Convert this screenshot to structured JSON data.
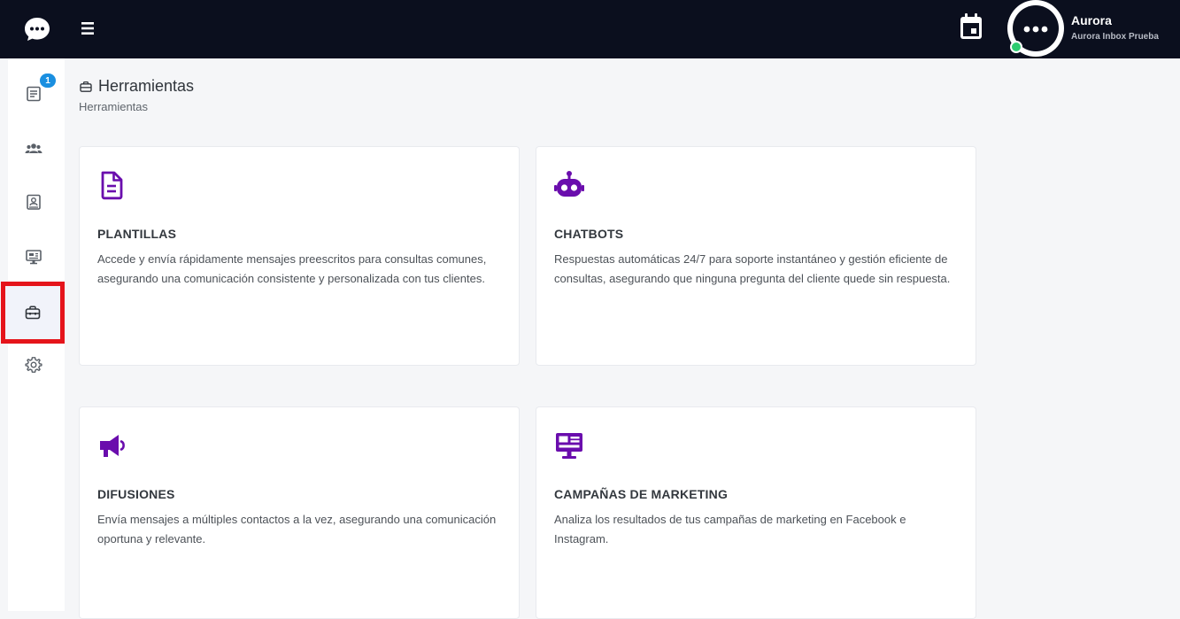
{
  "topbar": {
    "user_name": "Aurora",
    "user_org": "Aurora Inbox Prueba"
  },
  "sidebar": {
    "items": [
      {
        "name": "conversations",
        "icon": "list-icon",
        "badge": "1"
      },
      {
        "name": "contacts",
        "icon": "users-icon"
      },
      {
        "name": "contact-card",
        "icon": "contact-icon"
      },
      {
        "name": "monitor",
        "icon": "monitor-icon"
      },
      {
        "name": "tools",
        "icon": "toolbox-icon",
        "active": true
      },
      {
        "name": "settings",
        "icon": "gear-icon"
      }
    ]
  },
  "page": {
    "title": "Herramientas",
    "breadcrumb": "Herramientas"
  },
  "cards": [
    {
      "icon": "document-icon",
      "title": "PLANTILLAS",
      "description": "Accede y envía rápidamente mensajes preescritos para consultas comunes, asegurando una comunicación consistente y personalizada con tus clientes."
    },
    {
      "icon": "robot-icon",
      "title": "CHATBOTS",
      "description": "Respuestas automáticas 24/7 para soporte instantáneo y gestión eficiente de consultas, asegurando que ninguna pregunta del cliente quede sin respuesta."
    },
    {
      "icon": "megaphone-icon",
      "title": "DIFUSIONES",
      "description": "Envía mensajes a múltiples contactos a la vez, asegurando una comunicación oportuna y relevante."
    },
    {
      "icon": "monitor-chart-icon",
      "title": "CAMPAÑAS DE MARKETING",
      "description": "Analiza los resultados de tus campañas de marketing en Facebook e Instagram."
    }
  ],
  "colors": {
    "topbar": "#0b0f1e",
    "accent_purple": "#6a0dad",
    "badge_blue": "#1a8fe0",
    "status_green": "#2ecc71",
    "highlight_red": "#e5141b"
  }
}
